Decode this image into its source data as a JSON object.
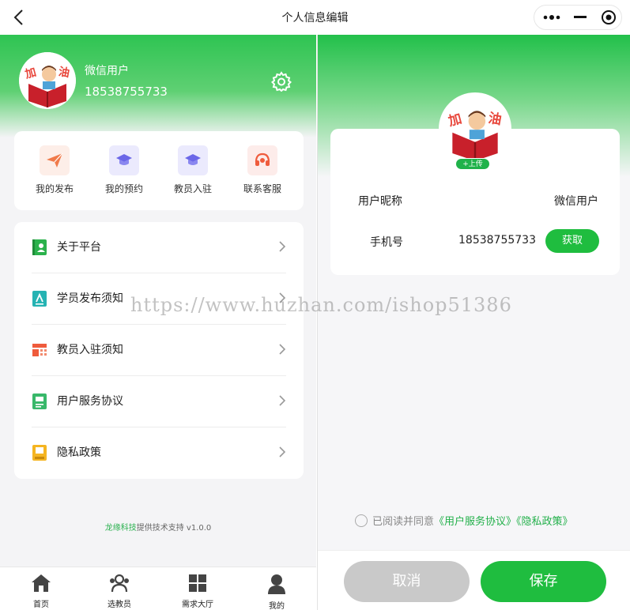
{
  "nav": {
    "title": "个人信息编辑"
  },
  "left": {
    "user": {
      "name": "微信用户",
      "phone": "18538755733"
    },
    "quick_actions": [
      {
        "label": "我的发布",
        "icon": "paper-plane-icon",
        "color": "#f07a4a"
      },
      {
        "label": "我的预约",
        "icon": "graduation-cap-icon",
        "color": "#6b67e8"
      },
      {
        "label": "教员入驻",
        "icon": "graduation-cap-icon",
        "color": "#6b67e8"
      },
      {
        "label": "联系客服",
        "icon": "headset-icon",
        "color": "#ef5b3c"
      }
    ],
    "menu": [
      {
        "label": "关于平台",
        "icon": "book-user-icon",
        "color": "#2bb24c"
      },
      {
        "label": "学员发布须知",
        "icon": "document-pen-icon",
        "color": "#25b3b3"
      },
      {
        "label": "教员入驻须知",
        "icon": "layout-grid-icon",
        "color": "#ef5b3c"
      },
      {
        "label": "用户服务协议",
        "icon": "agreement-icon",
        "color": "#38b86a"
      },
      {
        "label": "隐私政策",
        "icon": "privacy-book-icon",
        "color": "#f5b521"
      }
    ],
    "footer": {
      "brand": "龙缘科技",
      "text": "提供技术支持 v1.0.0"
    },
    "tabs": [
      {
        "label": "首页",
        "icon": "home-icon"
      },
      {
        "label": "选教员",
        "icon": "users-icon"
      },
      {
        "label": "需求大厅",
        "icon": "grid-icon"
      },
      {
        "label": "我的",
        "icon": "person-icon"
      }
    ]
  },
  "right": {
    "upload_label": "+上传",
    "nickname_label": "用户昵称",
    "nickname_value": "微信用户",
    "phone_label": "手机号",
    "phone_value": "18538755733",
    "get_button": "获取",
    "agree_text": "已阅读并同意",
    "agree_link1": "《用户服务协议》",
    "agree_link2": "《隐私政策》",
    "cancel_button": "取消",
    "save_button": "保存"
  },
  "watermark": "https://www.huzhan.com/ishop51386",
  "colors": {
    "primary": "#1fbd3f",
    "accent_text": "#22b04a"
  }
}
